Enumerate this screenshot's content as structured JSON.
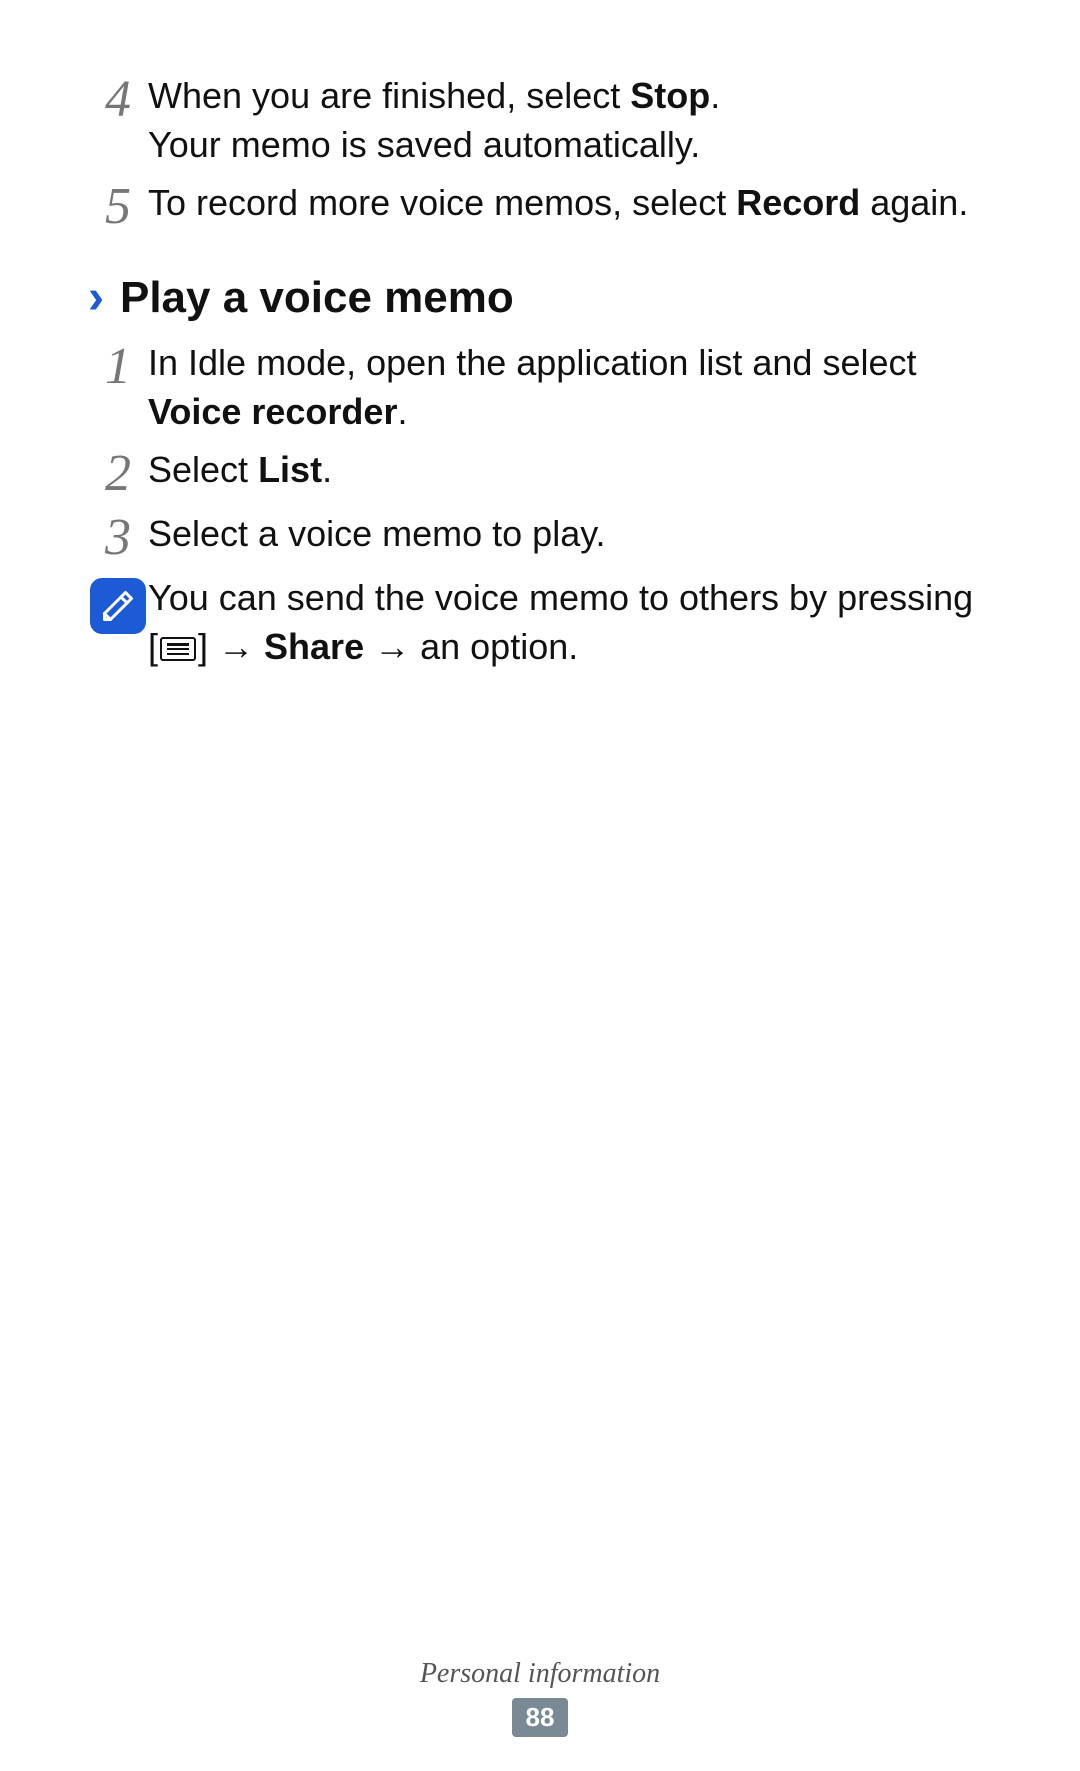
{
  "top_steps": [
    {
      "num": "4",
      "html": "When you are finished, select <b>Stop</b>.<br>Your memo is saved automatically."
    },
    {
      "num": "5",
      "html": "To record more voice memos, select <b>Record</b> again."
    }
  ],
  "section": {
    "title": "Play a voice memo"
  },
  "section_steps": [
    {
      "num": "1",
      "html": "In Idle mode, open the application list and select <b>Voice recorder</b>."
    },
    {
      "num": "2",
      "html": "Select <b>List</b>."
    },
    {
      "num": "3",
      "html": "Select a voice memo to play."
    }
  ],
  "note": {
    "line1": "You can send the voice memo to others by pressing",
    "share": "Share",
    "tail": "an option."
  },
  "footer": {
    "section": "Personal information",
    "page": "88"
  }
}
